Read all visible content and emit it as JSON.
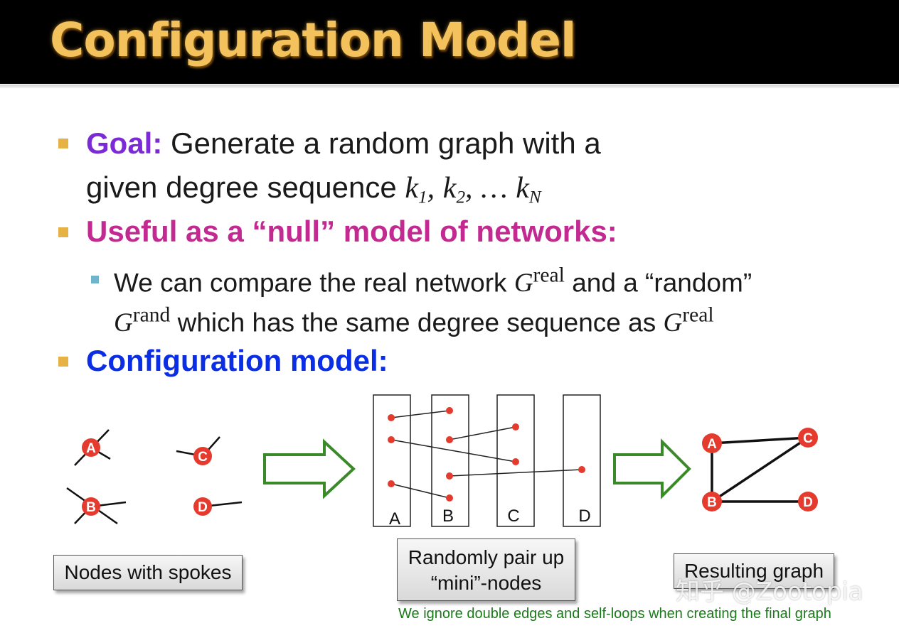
{
  "title": "Configuration Model",
  "bullets": {
    "goal_label": "Goal:",
    "goal_text_1": "Generate a random graph with a",
    "goal_text_2": "given degree sequence",
    "degree_seq": {
      "k": "k",
      "sub1": "1",
      "sub2": "2",
      "ellipsis": "…",
      "subN": "N",
      "comma": ","
    },
    "useful": "Useful as a “null” model of networks:",
    "sub_line_1a": "We can compare the real network",
    "sub_line_1b": "and a “random”",
    "sub_line_2": "which has the same degree sequence as",
    "G": "G",
    "real": "real",
    "rand": "rand",
    "config": "Configuration model:"
  },
  "diagram": {
    "spoke_nodes": [
      "A",
      "C",
      "B",
      "D"
    ],
    "mini_columns": [
      "A",
      "B",
      "C",
      "D"
    ],
    "result_nodes": [
      "A",
      "C",
      "B",
      "D"
    ],
    "node_color": "#e53a2e",
    "arrow_color": "#3a8a2a"
  },
  "labels": {
    "spokes": "Nodes with spokes",
    "pair_line1": "Randomly pair up",
    "pair_line2": "“mini”-nodes",
    "result": "Resulting graph"
  },
  "note": "We ignore double edges and self-loops when creating the final graph",
  "watermark": "知乎 @Zootopia"
}
